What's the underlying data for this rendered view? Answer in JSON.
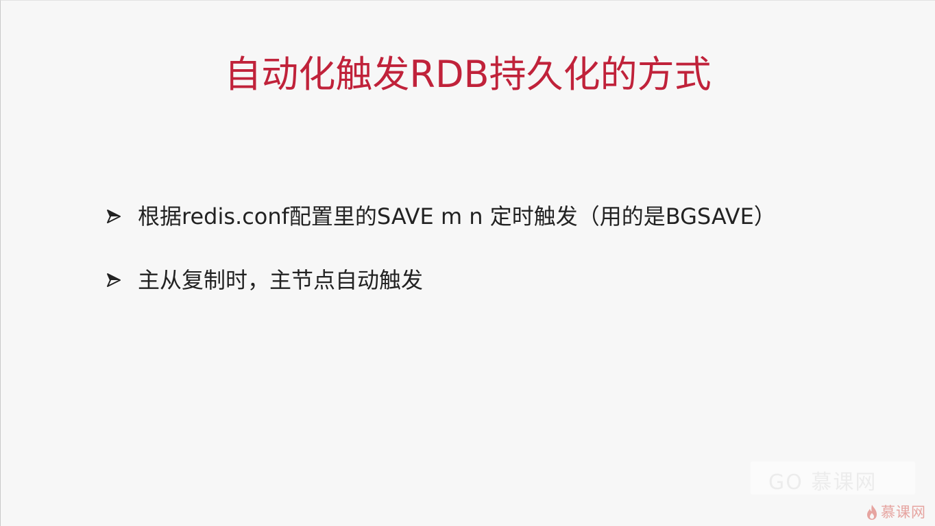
{
  "slide": {
    "title": "自动化触发RDB持久化的方式",
    "bullets": [
      {
        "text": "根据redis.conf配置里的SAVE m n 定时触发（用的是BGSAVE）"
      },
      {
        "text": "主从复制时，主节点自动触发"
      }
    ]
  },
  "branding": {
    "logo_text": "慕课网",
    "logo_icon": "flame-icon",
    "watermark_text": "GO 慕课网"
  },
  "colors": {
    "title": "#c0223a",
    "body_text": "#222222",
    "background": "#f7f7f7",
    "logo": "#e6a4a0"
  }
}
